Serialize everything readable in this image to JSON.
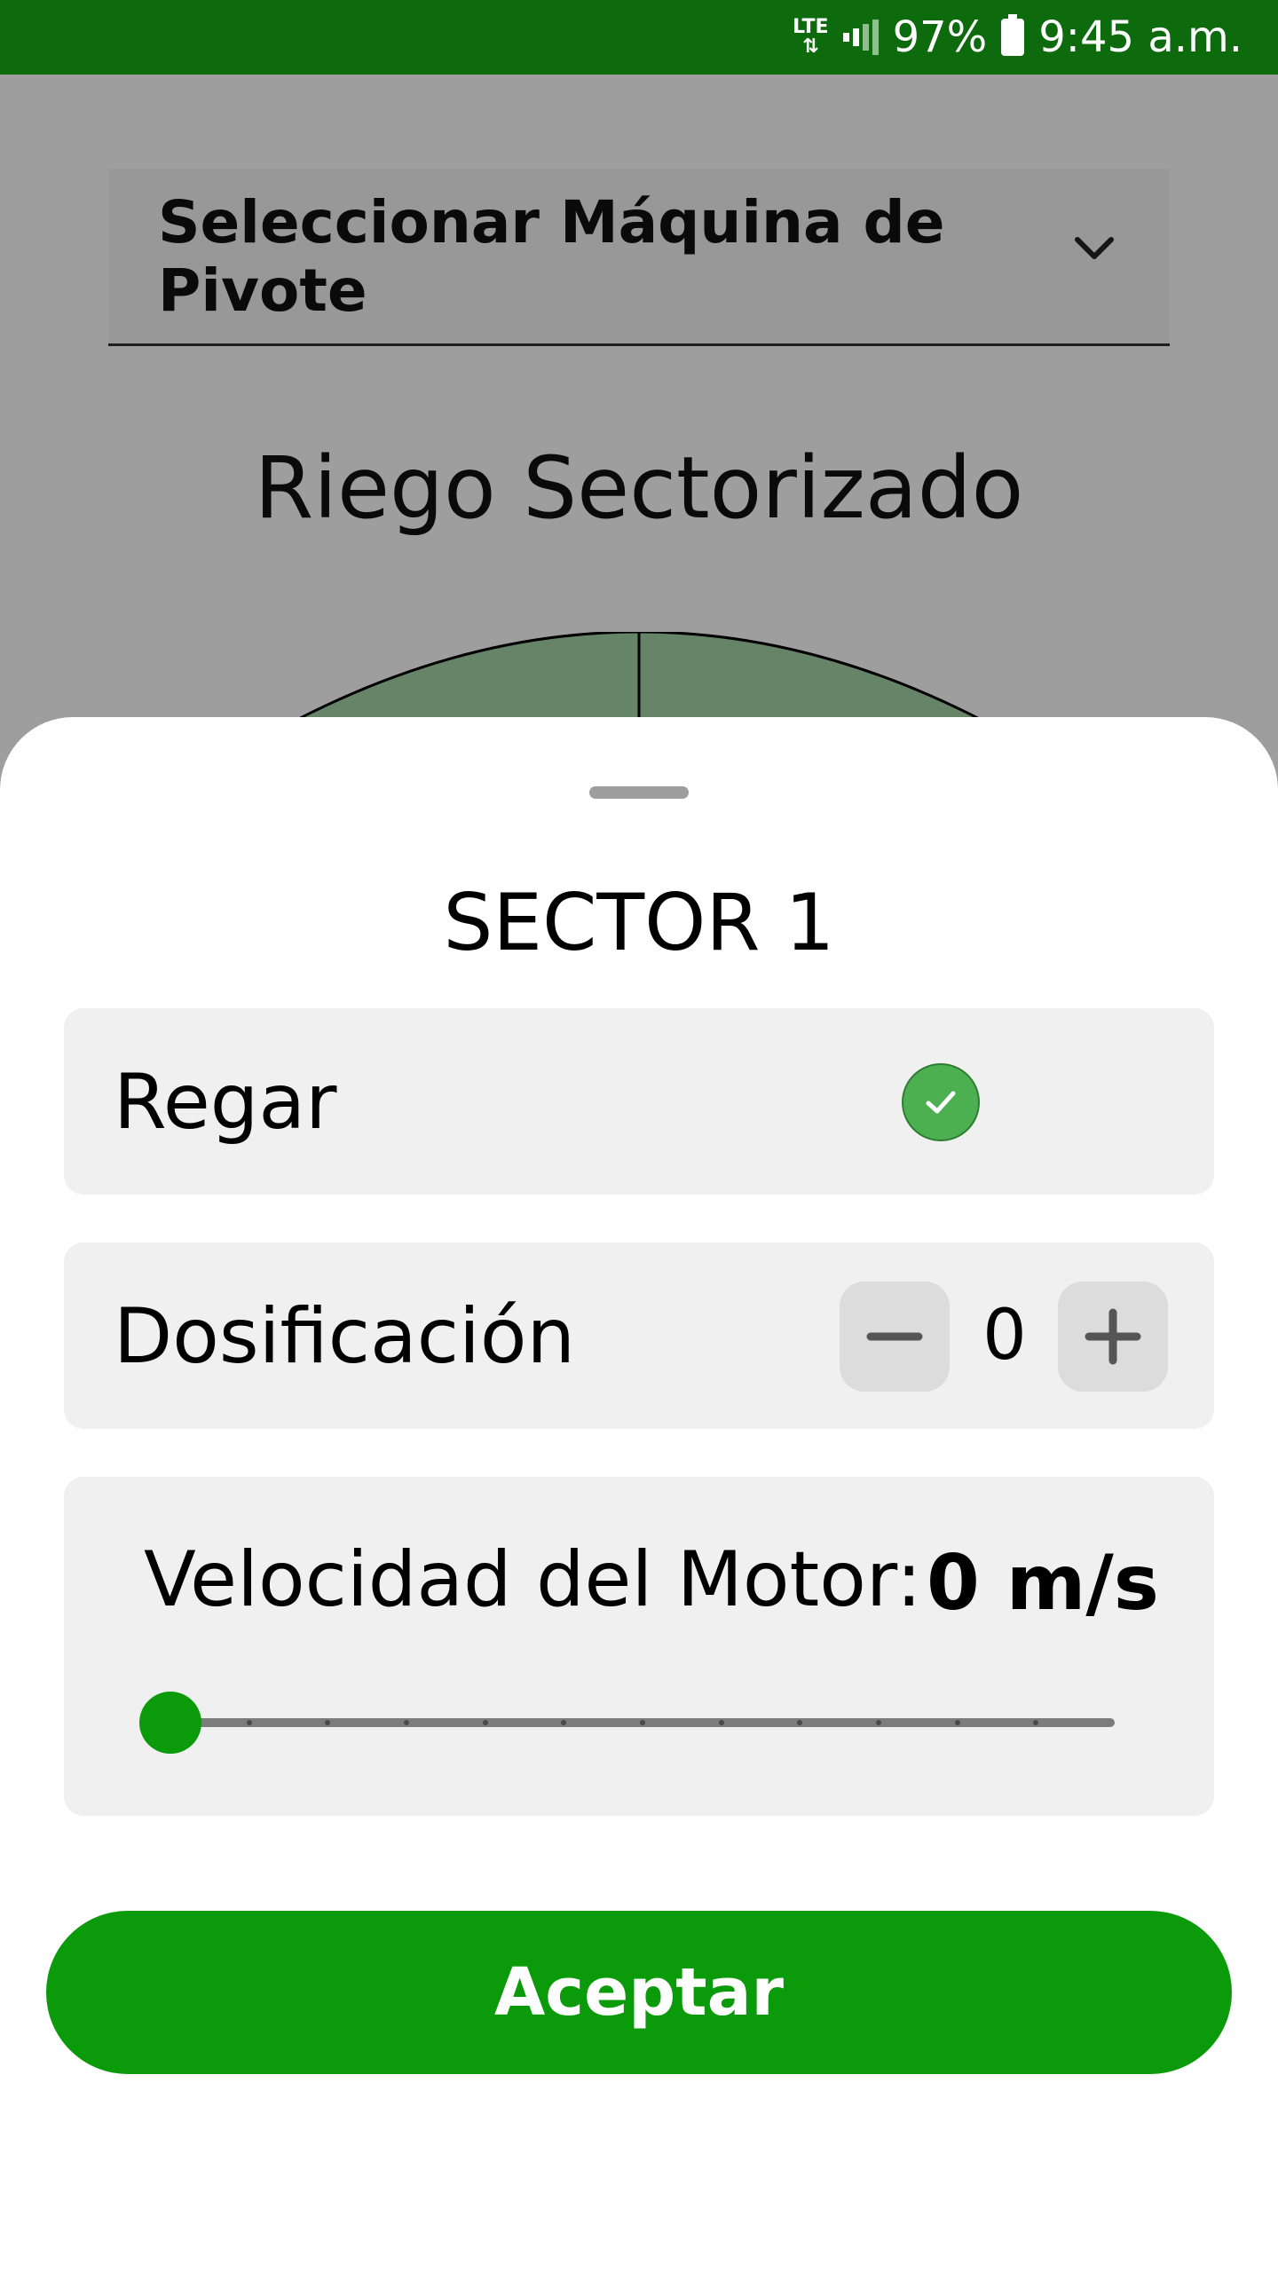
{
  "status_bar": {
    "network": "LTE",
    "battery": "97%",
    "time": "9:45 a.m.",
    "icons": [
      "lte-icon",
      "signal-icon",
      "battery-icon"
    ]
  },
  "background": {
    "dropdown_label": "Seleccionar Máquina de Pivote",
    "title": "Riego Sectorizado"
  },
  "sheet": {
    "title": "SECTOR 1",
    "regar": {
      "label": "Regar",
      "checked": true
    },
    "dosificacion": {
      "label": "Dosificación",
      "value": "0"
    },
    "velocidad": {
      "label": "Velocidad del Motor:",
      "value": "0 m/s",
      "slider_level": 0
    },
    "accept_label": "Aceptar"
  },
  "colors": {
    "status_bar": "#0d6a0d",
    "accent": "#0a9a0a",
    "check": "#4caf50",
    "sector_fill": "#a5d6a7"
  }
}
